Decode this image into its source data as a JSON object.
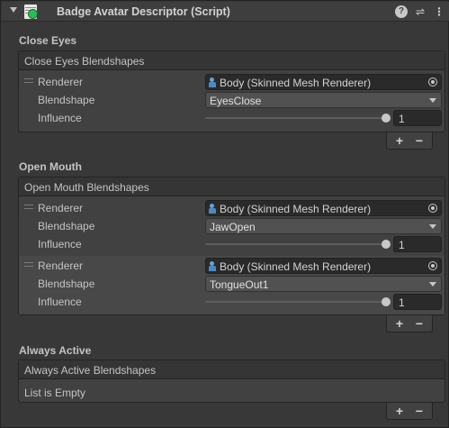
{
  "component": {
    "title": "Badge Avatar Descriptor (Script)",
    "icons": [
      "foldout-arrow",
      "script-icon",
      "help-icon",
      "preset-icon",
      "menu-icon"
    ]
  },
  "labels": {
    "renderer": "Renderer",
    "blendshape": "Blendshape",
    "influence": "Influence",
    "add": "+",
    "remove": "−"
  },
  "sections": [
    {
      "title": "Close Eyes",
      "list_header": "Close Eyes Blendshapes",
      "elements": [
        {
          "renderer": "Body (Skinned Mesh Renderer)",
          "blendshape": "EyesClose",
          "influence": 1
        }
      ]
    },
    {
      "title": "Open Mouth",
      "list_header": "Open Mouth Blendshapes",
      "elements": [
        {
          "renderer": "Body (Skinned Mesh Renderer)",
          "blendshape": "JawOpen",
          "influence": 1
        },
        {
          "renderer": "Body (Skinned Mesh Renderer)",
          "blendshape": "TongueOut1",
          "influence": 1
        }
      ]
    },
    {
      "title": "Always Active",
      "list_header": "Always Active Blendshapes",
      "empty_text": "List is Empty",
      "elements": []
    }
  ],
  "colors": {
    "background": "#383838",
    "script_badge": "#2dbb55",
    "mesh_icon": "#64a3d9"
  }
}
